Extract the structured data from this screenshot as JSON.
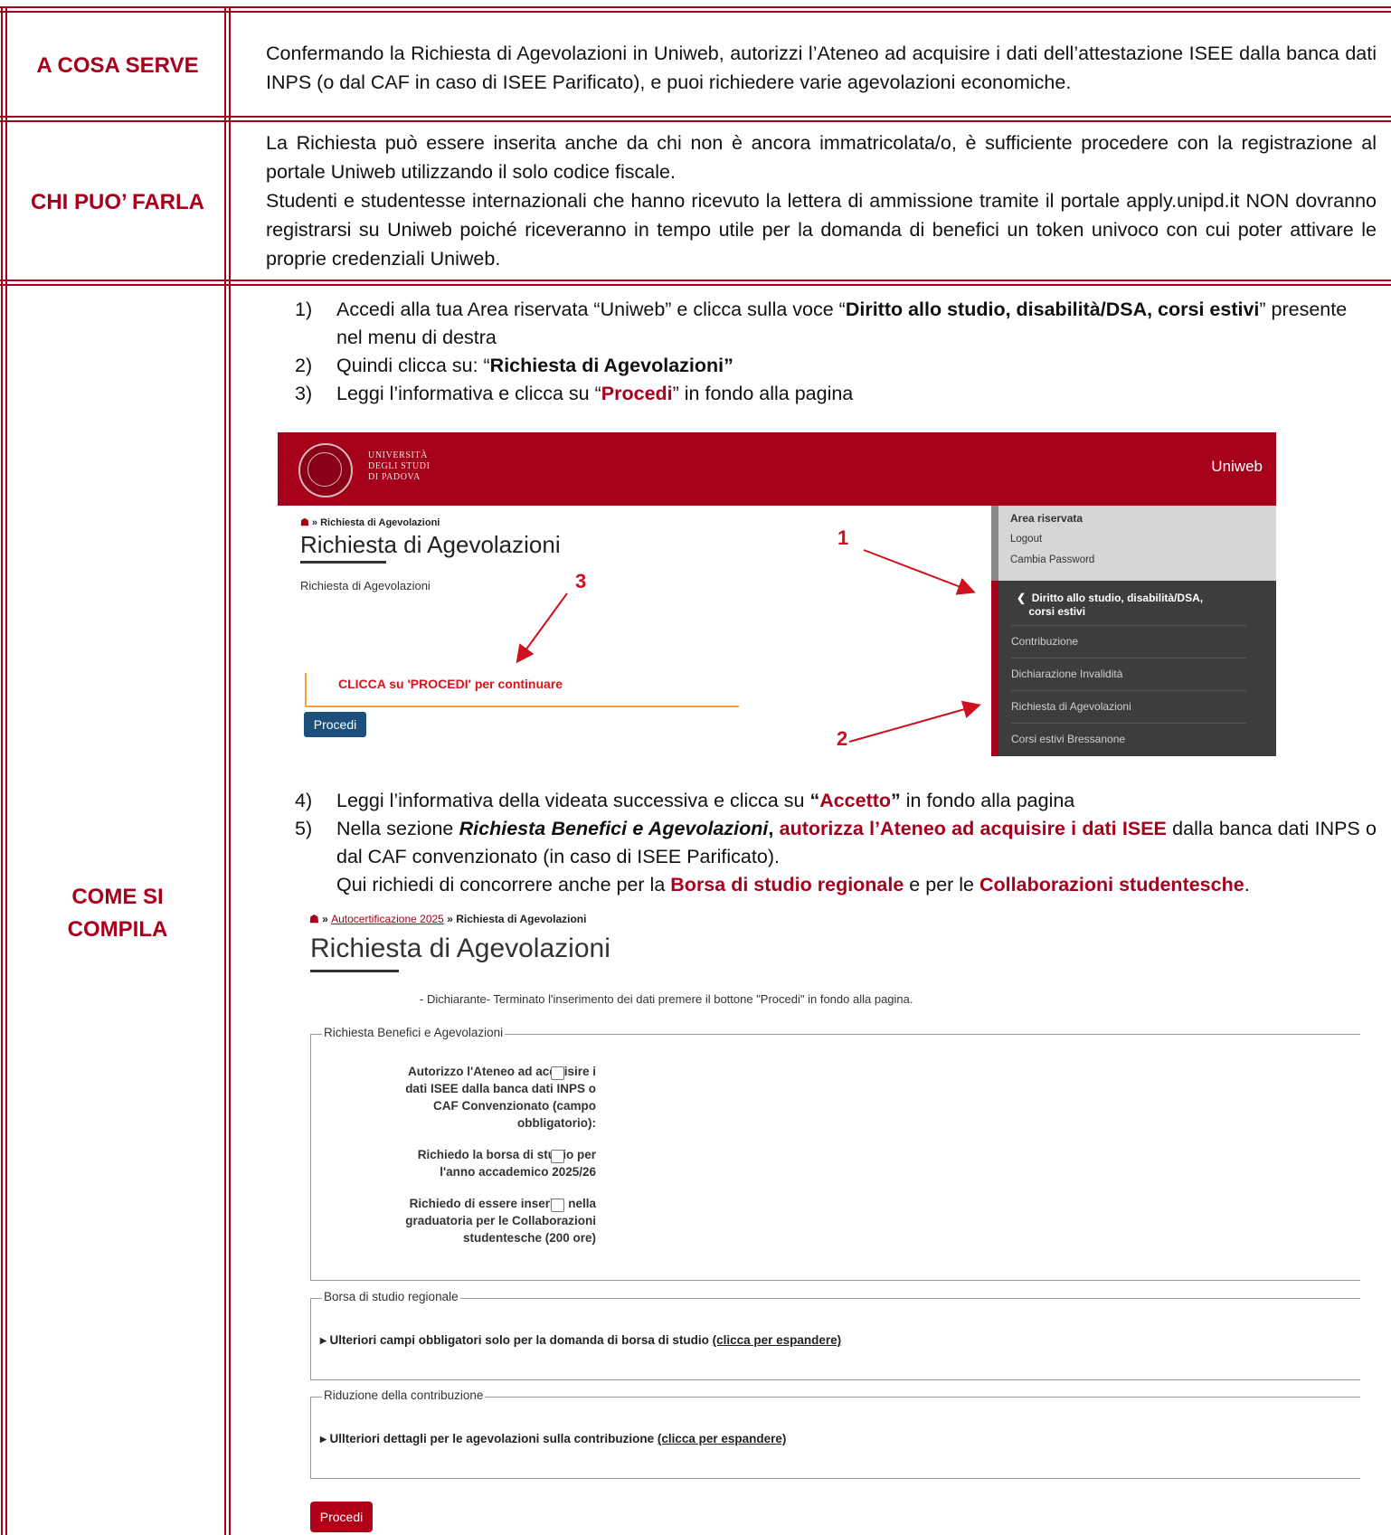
{
  "rows": {
    "cosa": {
      "label": "A COSA SERVE",
      "text": "Confermando la Richiesta di Agevolazioni in Uniweb, autorizzi l’Ateneo ad acquisire i dati dell’attestazione ISEE dalla banca dati INPS (o dal CAF in caso di ISEE Parificato), e puoi richiedere varie agevolazioni economiche."
    },
    "chi": {
      "label": "CHI PUO’ FARLA",
      "p1": "La Richiesta può essere inserita anche da chi non è ancora immatricolata/o, è sufficiente procedere con la registrazione al portale Uniweb utilizzando il solo codice fiscale.",
      "p2": "Studenti e studentesse internazionali che hanno ricevuto la lettera di ammissione tramite il portale apply.unipd.it NON dovranno registrarsi su Uniweb poiché riceveranno in tempo utile per la domanda di benefici un token univoco con cui poter attivare le proprie credenziali Uniweb."
    },
    "come": {
      "label_line1": "COME SI",
      "label_line2": "COMPILA",
      "s1_num": "1)",
      "s1_a": "Accedi alla tua Area riservata “Uniweb” e clicca sulla voce “",
      "s1_b": "Diritto allo studio, disabilità/DSA, corsi estivi",
      "s1_c": "” presente nel menu di destra",
      "s2_num": "2)",
      "s2_a": "Quindi clicca su: “",
      "s2_b": "Richiesta di Agevolazioni”",
      "s3_num": "3)",
      "s3_a": "Leggi l’informativa e clicca su “",
      "s3_b": "Procedi",
      "s3_c": "” in fondo alla pagina",
      "s4_num": "4)",
      "s4_a": "Leggi l’informativa della videata successiva e clicca su ",
      "s4_q1": "“",
      "s4_b": "Accetto",
      "s4_q2": "”",
      "s4_c": " in fondo alla pagina",
      "s5_num": "5)",
      "s5_a": "Nella sezione ",
      "s5_b": "Richiesta Benefici e Agevolazioni",
      "s5_comma": ",",
      "s5_c": " autorizza l’Ateneo ad acquisire i dati ISEE",
      "s5_d": " dalla banca dati INPS o dal CAF convenzionato (in caso di ISEE Parificato).",
      "s5_e": "Qui richiedi di concorrere anche per la ",
      "s5_f": "Borsa di studio regionale",
      "s5_g": " e per le ",
      "s5_h": "Collaborazioni studentesche",
      "s5_i": "."
    }
  },
  "shot1": {
    "logo_l1": "UNIVERSITÀ",
    "logo_l2": "DEGLI STUDI",
    "logo_l3": "DI PADOVA",
    "brand": "Uniweb",
    "crumb_sep": " » ",
    "crumb": "Richiesta di Agevolazioni",
    "title": "Richiesta di Agevolazioni",
    "sub": "Richiesta di Agevolazioni",
    "warn": "CLICCA su 'PROCEDI' per continuare",
    "button": "Procedi",
    "menu_title": "Area riservata",
    "logout": "Logout",
    "change_pw": "Cambia Password",
    "menu_active_l1": "Diritto allo studio, disabilità/DSA,",
    "menu_active_l2": "corsi estivi",
    "menu_items": [
      "Contribuzione",
      "Dichiarazione Invalidità",
      "Richiesta di Agevolazioni",
      "Corsi estivi Bressanone"
    ],
    "arrow1": "1",
    "arrow2": "2",
    "arrow3": "3"
  },
  "shot2": {
    "crumb_sep": " » ",
    "crumb_link": "Autocertificazione 2025",
    "crumb_sep2": " » ",
    "crumb_current": "Richiesta di Agevolazioni",
    "title": "Richiesta di Agevolazioni",
    "dichiarante": "- Dichiarante- Terminato l'inserimento dei dati premere il bottone \"Procedi\" in fondo alla pagina.",
    "fs1_legend": "Richiesta Benefici e Agevolazioni",
    "field1": "Autorizzo l'Ateneo ad acquisire i dati ISEE dalla banca dati INPS o CAF Convenzionato (campo obbligatorio):",
    "field2": "Richiedo la borsa di studio per l'anno accademico 2025/26",
    "field3": "Richiedo di essere inserito nella graduatoria per le Collaborazioni studentesche (200 ore)",
    "fs2_legend": "Borsa di studio regionale",
    "fs2_text": "▸ Ulteriori campi obbligatori solo per la domanda di borsa di studio ",
    "fs2_click": "(clicca per espandere)",
    "fs3_legend": "Riduzione della contribuzione",
    "fs3_text": "▸ Ullteriori dettagli per le agevolazioni sulla contribuzione ",
    "fs3_click": "(clicca per espandere)",
    "button": "Procedi"
  }
}
